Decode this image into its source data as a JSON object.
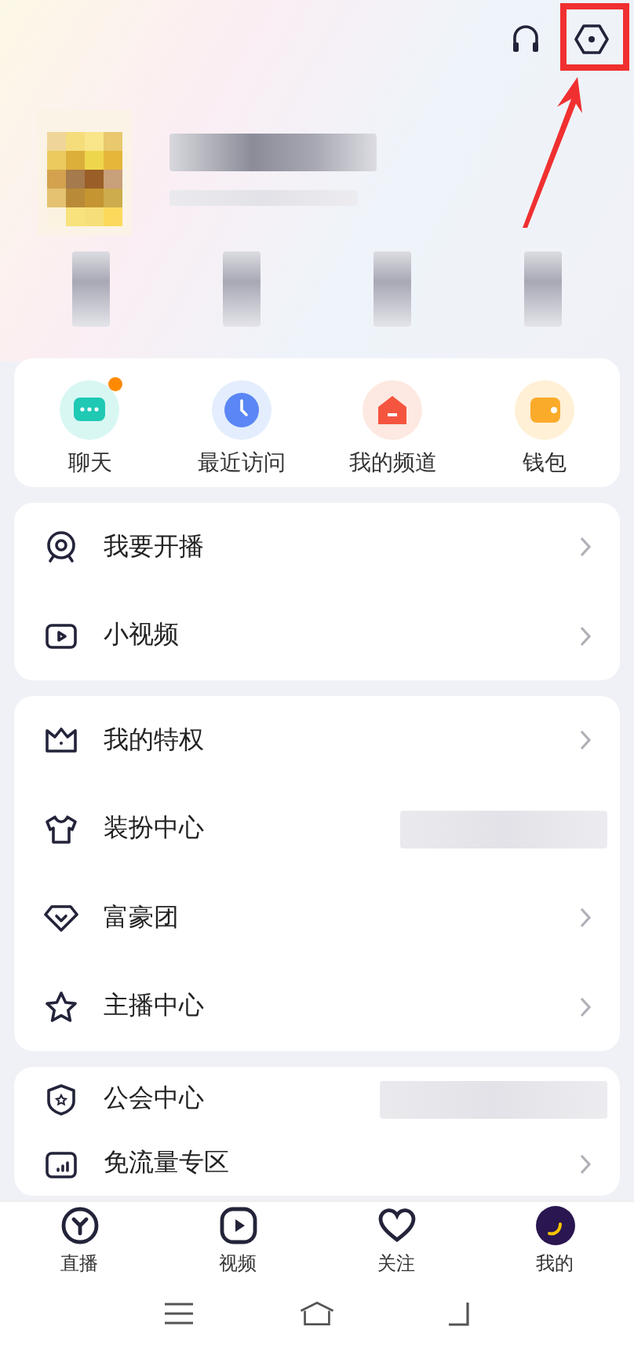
{
  "quick_actions": [
    {
      "label": "聊天",
      "kind": "chat",
      "dot": true
    },
    {
      "label": "最近访问",
      "kind": "recent",
      "dot": false
    },
    {
      "label": "我的频道",
      "kind": "channel",
      "dot": false
    },
    {
      "label": "钱包",
      "kind": "wallet",
      "dot": false
    }
  ],
  "menu_groups": [
    {
      "items": [
        {
          "label": "我要开播",
          "kind": "webcam",
          "redacted": false
        },
        {
          "label": "小视频",
          "kind": "video",
          "redacted": false
        }
      ]
    },
    {
      "items": [
        {
          "label": "我的特权",
          "kind": "crown",
          "redacted": false
        },
        {
          "label": "装扮中心",
          "kind": "shirt",
          "redacted": true
        },
        {
          "label": "富豪团",
          "kind": "diamond",
          "redacted": false
        },
        {
          "label": "主播中心",
          "kind": "star",
          "redacted": false
        }
      ]
    },
    {
      "items": [
        {
          "label": "公会中心",
          "kind": "shield",
          "redacted": true
        },
        {
          "label": "免流量专区",
          "kind": "signal",
          "redacted": false
        }
      ]
    }
  ],
  "bottom_nav": [
    {
      "label": "直播",
      "kind": "live"
    },
    {
      "label": "视频",
      "kind": "play"
    },
    {
      "label": "关注",
      "kind": "heart"
    },
    {
      "label": "我的",
      "kind": "avatar"
    }
  ]
}
